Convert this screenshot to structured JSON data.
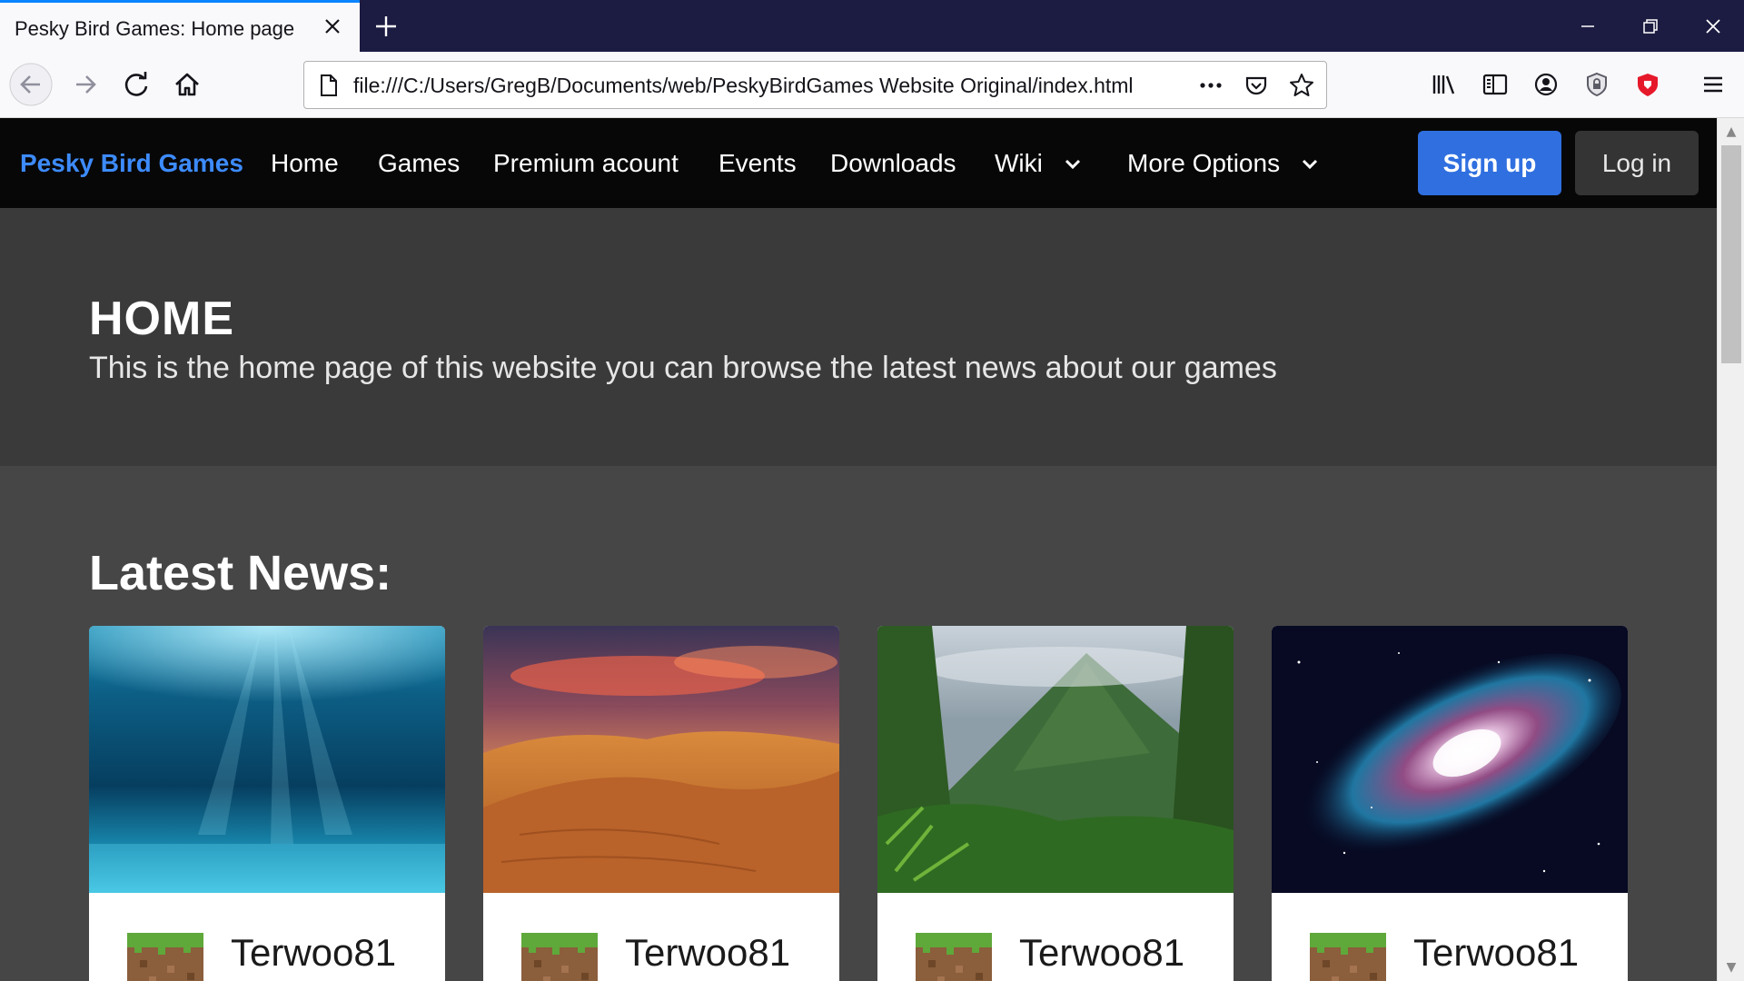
{
  "browser": {
    "tab_title": "Pesky Bird Games: Home page",
    "url": "file:///C:/Users/GregB/Documents/web/PeskyBirdGames Website Original/index.html",
    "colors": {
      "tab_accent": "#0a84ff",
      "tabbar_bg": "#1c1b41",
      "toolbar_bg": "#f9f9fb"
    }
  },
  "site": {
    "brand": "Pesky Bird Games",
    "nav": {
      "home": "Home",
      "games": "Games",
      "premium": "Premium acount",
      "events": "Events",
      "downloads": "Downloads",
      "wiki": "Wiki",
      "more": "More Options"
    },
    "signup": "Sign up",
    "login": "Log in",
    "colors": {
      "brand": "#3d8bfd",
      "signup_bg": "#2f6fe0",
      "nav_bg": "#070707"
    }
  },
  "hero": {
    "title": "HOME",
    "subtitle": "This is the home page of this website you can browse the latest news about our games"
  },
  "news": {
    "title": "Latest News:",
    "cards": [
      {
        "author": "Terwoo81",
        "image": "underwater"
      },
      {
        "author": "Terwoo81",
        "image": "desert-dunes"
      },
      {
        "author": "Terwoo81",
        "image": "jungle-mountain"
      },
      {
        "author": "Terwoo81",
        "image": "galaxy"
      }
    ]
  }
}
